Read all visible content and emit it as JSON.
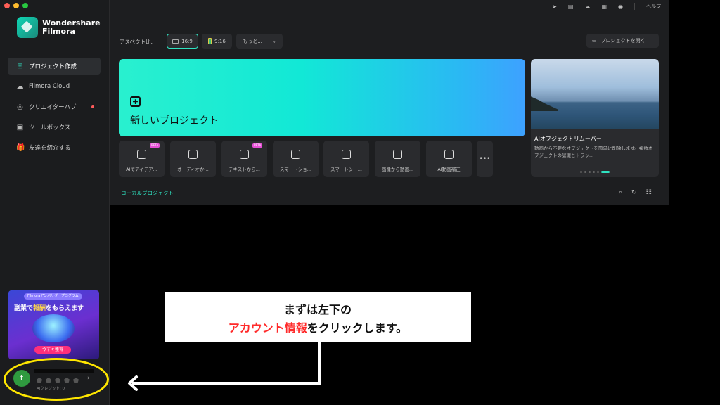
{
  "app": {
    "logo_line1": "Wondershare",
    "logo_line2": "Filmora"
  },
  "sidebar": {
    "items": [
      {
        "label": "プロジェクト作成",
        "icon": "new-project-icon",
        "active": true
      },
      {
        "label": "Filmora Cloud",
        "icon": "cloud-icon"
      },
      {
        "label": "クリエイターハブ",
        "icon": "bulb-icon",
        "notify": true
      },
      {
        "label": "ツールボックス",
        "icon": "toolbox-icon"
      },
      {
        "label": "友達を紹介する",
        "icon": "gift-icon"
      }
    ],
    "banner": {
      "pill": "Filmoraアンバサダープログラム",
      "headline_pre": "副業で",
      "headline_highlight": "報酬",
      "headline_post": "をもらえます",
      "cta": "今すぐ獲得"
    },
    "account": {
      "avatar_letter": "t",
      "credit_label": "AIクレジット: 0"
    }
  },
  "header": {
    "help": "ヘルプ"
  },
  "toolbar": {
    "aspect_label": "アスペクト比:",
    "ratio_16_9": "16:9",
    "ratio_9_16": "9:16",
    "more_label": "もっと...",
    "open_project": "プロジェクトを開く"
  },
  "new_project": {
    "title": "新しいプロジェクト"
  },
  "tools": [
    {
      "label": "AIでアイデア...",
      "beta": "BETA"
    },
    {
      "label": "オーディオか..."
    },
    {
      "label": "テキストから...",
      "beta": "BETA"
    },
    {
      "label": "スマートショ..."
    },
    {
      "label": "スマートシー..."
    },
    {
      "label": "画像から動画..."
    },
    {
      "label": "AI動画補正"
    }
  ],
  "promo": {
    "title": "AIオブジェクトリムーバー",
    "desc": "動画から不要なオブジェクトを簡単に削除します。複数オブジェクトの認識とトラッ..."
  },
  "local": {
    "label": "ローカルプロジェクト"
  },
  "callout": {
    "line1": "まずは左下の",
    "line2_red": "アカウント情報",
    "line2_rest": "をクリックします。"
  },
  "colors": {
    "accent": "#2fe3c1",
    "highlight_ring": "#ffe600",
    "callout_red": "#ff2a2a"
  }
}
